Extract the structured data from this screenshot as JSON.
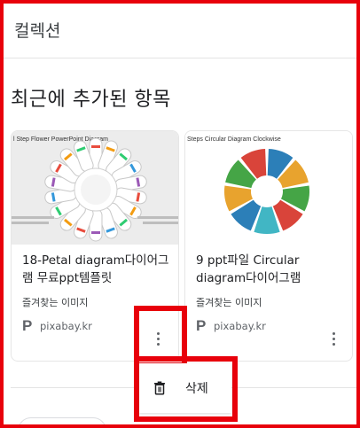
{
  "header": {
    "title": "컬렉션"
  },
  "section": {
    "title": "최근에 추가된 항목"
  },
  "cards": [
    {
      "thumb_caption": "l Step Flower PowerPoint Diagram",
      "title": "18-Petal diagram다이어그램 무료ppt템플릿",
      "subtitle": "즐겨찾는 이미지",
      "source_icon": "P",
      "source": "pixabay.kr"
    },
    {
      "thumb_caption": "Steps Circular Diagram Clockwise",
      "title": "9 ppt파일 Circular diagram다이어그램",
      "subtitle": "즐겨찾는 이미지",
      "source_icon": "P",
      "source": "pixabay.kr"
    }
  ],
  "menu": {
    "delete_label": "삭제",
    "icon": "trash-icon"
  },
  "colors": {
    "highlight": "#e8000b",
    "petal_palette": [
      "#e84c3d",
      "#f39c12",
      "#2ecc71",
      "#3498db",
      "#9b59b6"
    ],
    "cycle_palette": [
      "#2c7fb8",
      "#e8a32e",
      "#45a546",
      "#d9443a",
      "#41b6c4"
    ]
  }
}
